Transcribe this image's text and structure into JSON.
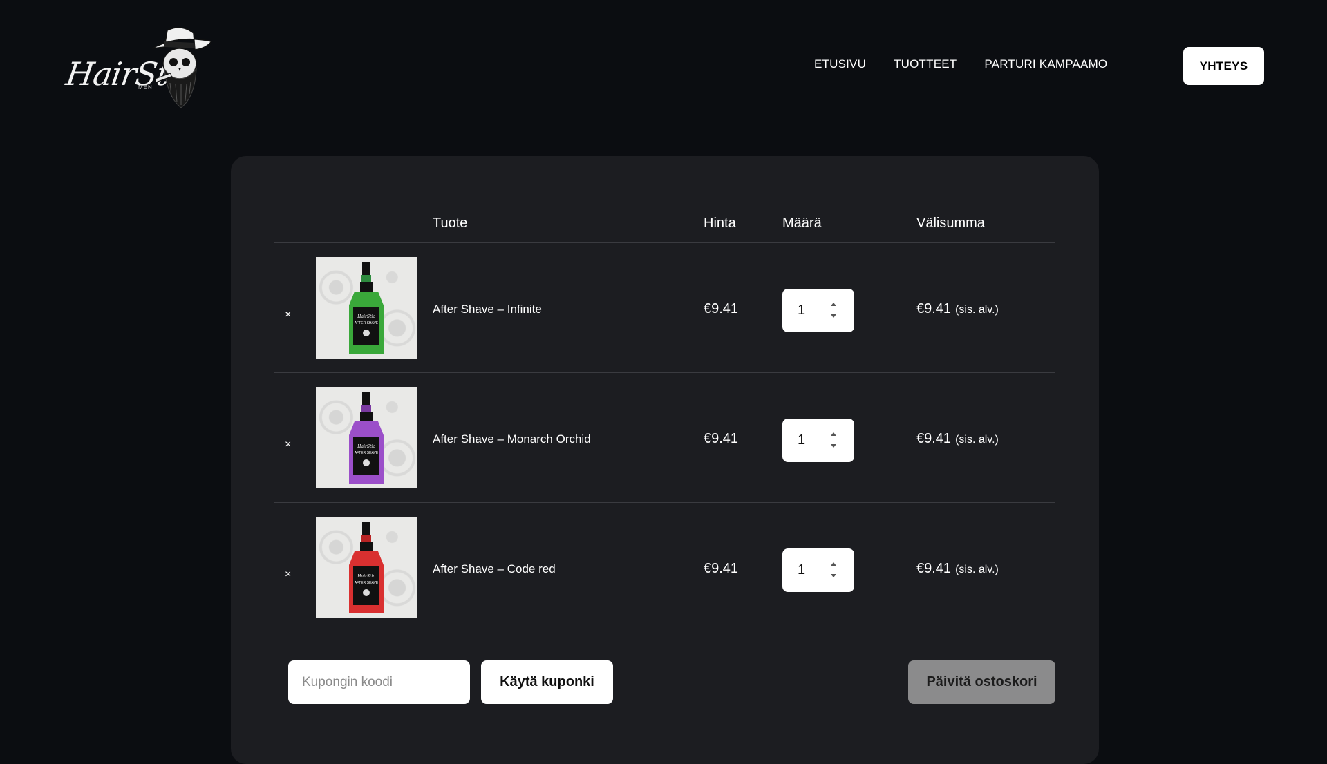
{
  "header": {
    "logo_text": "HairStic",
    "logo_subtext": "MEN",
    "nav": [
      "ETUSIVU",
      "TUOTTEET",
      "PARTURI KAMPAAMO"
    ],
    "contact_label": "YHTEYS"
  },
  "cart": {
    "columns": {
      "product": "Tuote",
      "price": "Hinta",
      "quantity": "Määrä",
      "subtotal": "Välisumma"
    },
    "remove_symbol": "×",
    "items": [
      {
        "name": "After Shave – Infinite",
        "price": "€9.41",
        "quantity": "1",
        "subtotal": "€9.41",
        "tax_note": "(sis. alv.)",
        "liquid_color": "#3aa83a",
        "cap_color": "#2e8b3e"
      },
      {
        "name": "After Shave – Monarch Orchid",
        "price": "€9.41",
        "quantity": "1",
        "subtotal": "€9.41",
        "tax_note": "(sis. alv.)",
        "liquid_color": "#9b4fc9",
        "cap_color": "#7a3aa0"
      },
      {
        "name": "After Shave – Code red",
        "price": "€9.41",
        "quantity": "1",
        "subtotal": "€9.41",
        "tax_note": "(sis. alv.)",
        "liquid_color": "#d93030",
        "cap_color": "#b82424"
      }
    ]
  },
  "actions": {
    "coupon_placeholder": "Kupongin koodi",
    "apply_coupon_label": "Käytä kuponki",
    "update_cart_label": "Päivitä ostoskori"
  },
  "colors": {
    "page_bg": "#0b0d11",
    "panel_bg": "#1c1d21",
    "update_button_bg": "#8b8b8c"
  }
}
